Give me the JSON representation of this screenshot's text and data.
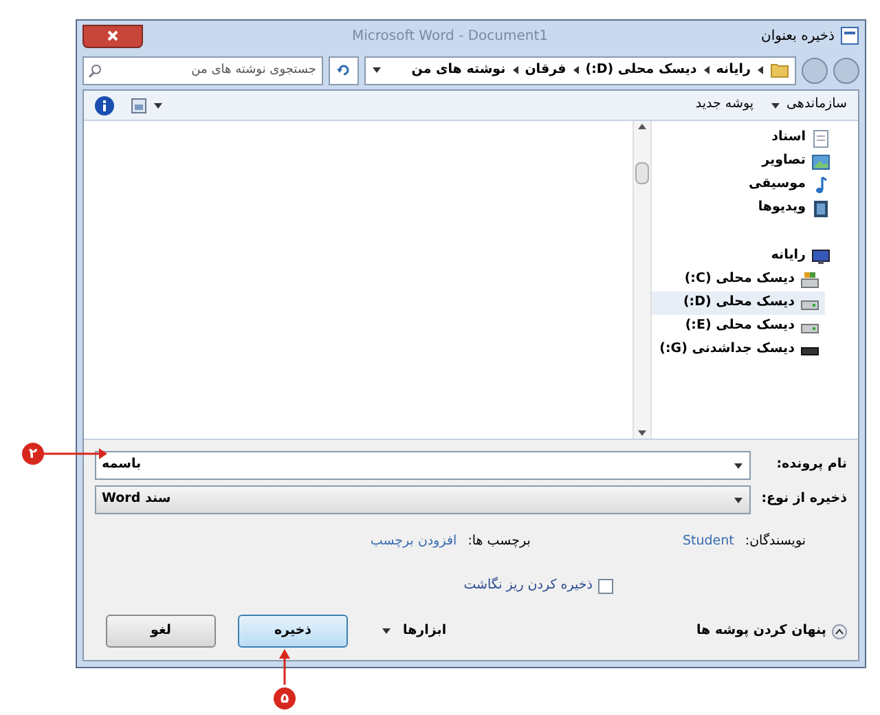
{
  "window": {
    "title": "ذخیره بعنوان",
    "caption": "Microsoft Word - Document1"
  },
  "address_bar": {
    "path": [
      "رایانه",
      "دیسک محلی (D:)",
      "فرقان",
      "نوشته های من"
    ]
  },
  "search": {
    "placeholder": "جستجوی نوشته های من"
  },
  "toolbar": {
    "organize": "سازماندهی",
    "new_folder": "پوشه جدید"
  },
  "libraries": [
    {
      "label": "اسناد",
      "kind": "document",
      "selected": false
    },
    {
      "label": "تصاویر",
      "kind": "picture",
      "selected": false
    },
    {
      "label": "موسیقی",
      "kind": "music",
      "selected": false
    },
    {
      "label": "ویدیوها",
      "kind": "video",
      "selected": false
    }
  ],
  "computer": {
    "label": "رایانه",
    "children": [
      {
        "label": "دیسک محلی (C:)",
        "kind": "system-drive",
        "selected": false
      },
      {
        "label": "دیسک محلی (D:)",
        "kind": "drive",
        "selected": true
      },
      {
        "label": "دیسک محلی (E:)",
        "kind": "drive",
        "selected": false
      },
      {
        "label": "دیسک جداشدنی (G:)",
        "kind": "removable",
        "selected": false
      }
    ]
  },
  "file_name": {
    "label": "نام پرونده:",
    "value": "باسمه"
  },
  "save_as_type": {
    "label": "ذخیره از نوع:",
    "value": "سند Word"
  },
  "authors": {
    "label": "نویسندگان:",
    "value": "Student"
  },
  "tags": {
    "label": "برچسب ها:",
    "value": "افزودن برچسب"
  },
  "thumbnail": {
    "label": "ذخیره کردن ریز نگاشت",
    "checked": false
  },
  "hide_folders": "پنهان کردن پوشه ها",
  "tools": "ابزارها",
  "buttons": [
    {
      "label": "ذخیره",
      "default": true
    },
    {
      "label": "لغو",
      "default": false
    }
  ],
  "callouts": [
    "۲",
    "۵"
  ]
}
